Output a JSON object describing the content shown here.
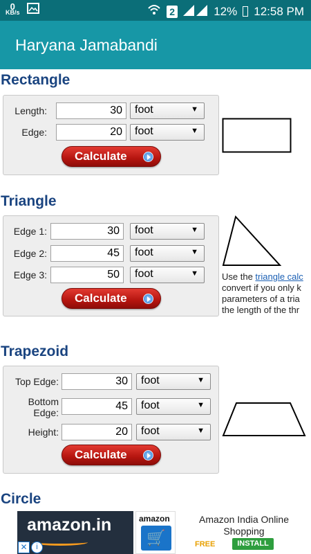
{
  "status_bar": {
    "net_speed": "0",
    "net_unit": "KB/s",
    "sim_slot": "2",
    "battery": "12%",
    "time": "12:58 PM"
  },
  "app_bar": {
    "title": "Haryana Jamabandi"
  },
  "rectangle": {
    "heading": "Rectangle",
    "length_label": "Length:",
    "length_value": "30",
    "length_unit": "foot",
    "edge_label": "Edge:",
    "edge_value": "20",
    "edge_unit": "foot",
    "calculate_label": "Calculate"
  },
  "triangle": {
    "heading": "Triangle",
    "edge1_label": "Edge 1:",
    "edge1_value": "30",
    "edge1_unit": "foot",
    "edge2_label": "Edge 2:",
    "edge2_value": "45",
    "edge2_unit": "foot",
    "edge3_label": "Edge 3:",
    "edge3_value": "50",
    "edge3_unit": "foot",
    "calculate_label": "Calculate",
    "note_prefix": "Use the ",
    "note_link": "triangle calc",
    "note_line2": "convert if you only k",
    "note_line3": "parameters of a tria",
    "note_line4": "the length of the thr"
  },
  "trapezoid": {
    "heading": "Trapezoid",
    "top_label": "Top Edge:",
    "top_value": "30",
    "top_unit": "foot",
    "bottom_label_1": "Bottom",
    "bottom_label_2": "Edge:",
    "bottom_value": "45",
    "bottom_unit": "foot",
    "height_label": "Height:",
    "height_value": "20",
    "height_unit": "foot",
    "calculate_label": "Calculate"
  },
  "circle": {
    "heading": "Circle"
  },
  "ad": {
    "brand": "amazon.in",
    "icon_brand": "amazon",
    "app_name_line1": "Amazon India Online",
    "app_name_line2": "Shopping",
    "price": "FREE",
    "install_label": "INSTALL"
  },
  "colors": {
    "status_bar": "#0b6e78",
    "app_bar": "#1797a6",
    "heading": "#1a4480",
    "calculate_button": "#b5150f"
  }
}
